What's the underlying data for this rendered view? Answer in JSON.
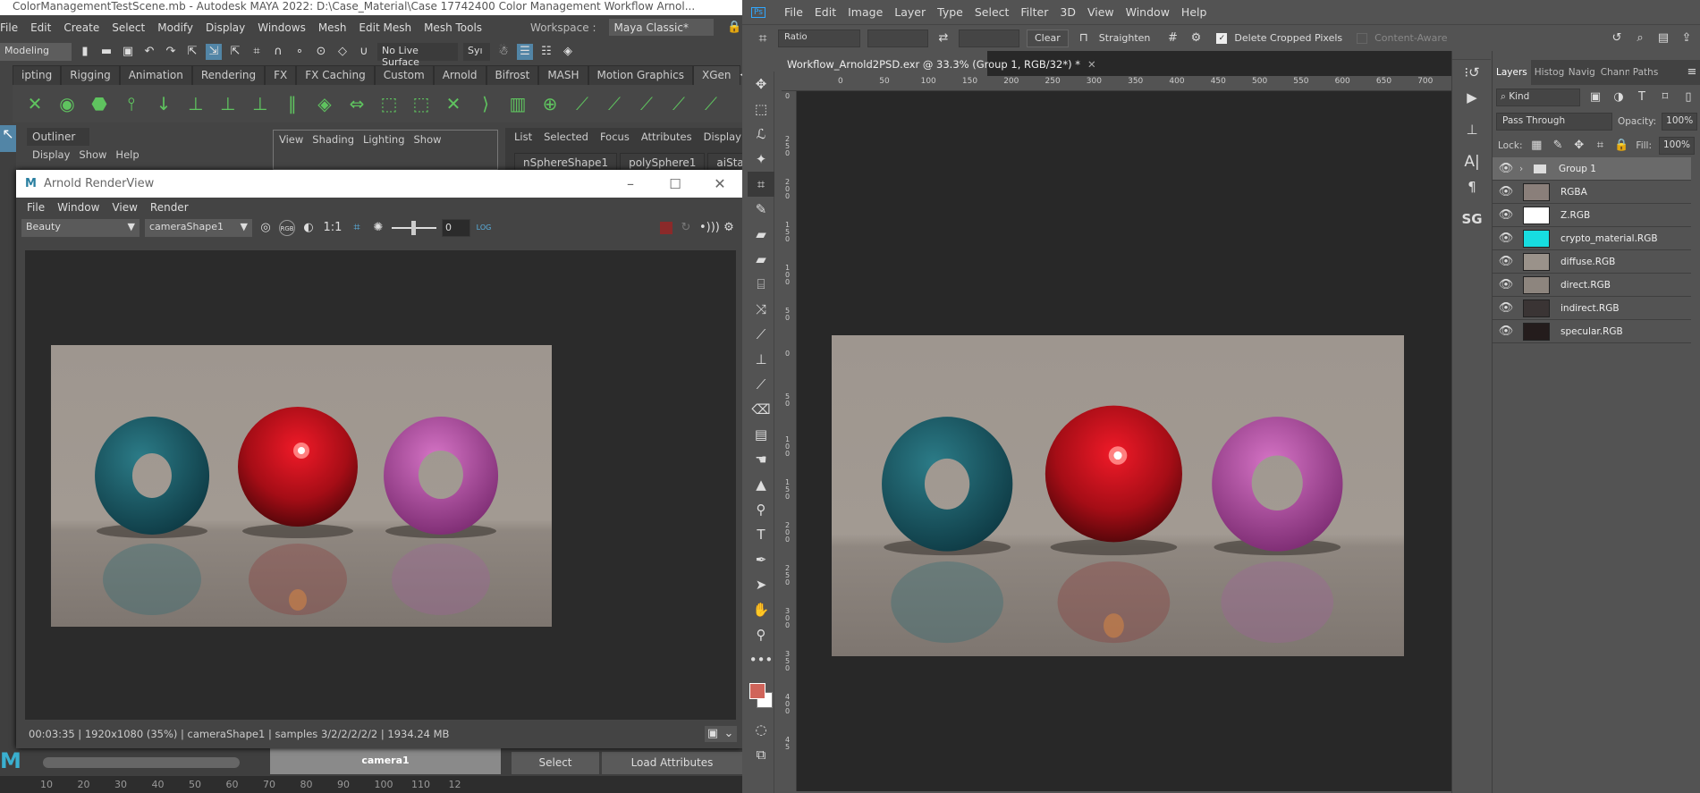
{
  "maya": {
    "title": "ColorManagementTestScene.mb - Autodesk MAYA 2022: D:\\Case_Material\\Case 17742400 Color Management Workflow Arnol...",
    "menu": [
      "File",
      "Edit",
      "Create",
      "Select",
      "Modify",
      "Display",
      "Windows",
      "Mesh",
      "Edit Mesh",
      "Mesh Tools"
    ],
    "workspace_label": "Workspace :",
    "workspace_value": "Maya Classic*",
    "mode": "Modeling",
    "live_surface": "No Live Surface",
    "sym": "Syı",
    "shelf_tabs": [
      "ipting",
      "Rigging",
      "Animation",
      "Rendering",
      "FX",
      "FX Caching",
      "Custom",
      "Arnold",
      "Bifrost",
      "MASH",
      "Motion Graphics",
      "XGen"
    ],
    "active_shelf": "XGen",
    "outliner": {
      "title": "Outliner",
      "menu": [
        "Display",
        "Show",
        "Help"
      ]
    },
    "panel_menu": [
      "View",
      "Shading",
      "Lighting",
      "Show"
    ],
    "attr_menu": [
      "List",
      "Selected",
      "Focus",
      "Attributes",
      "Display"
    ],
    "attr_tabs": [
      "nSphereShape1",
      "polySphere1",
      "aiStandard"
    ],
    "bottom": {
      "camera": "camera1",
      "select": "Select",
      "load_attributes": "Load Attributes"
    },
    "timeline": [
      "10",
      "20",
      "30",
      "40",
      "50",
      "60",
      "70",
      "80",
      "90",
      "100",
      "110",
      "12"
    ]
  },
  "renderview": {
    "title": "Arnold RenderView",
    "menu": [
      "File",
      "Window",
      "View",
      "Render"
    ],
    "aov": "Beauty",
    "camera": "cameraShape1",
    "ratio": "1:1",
    "exposure": "0",
    "log": "LOG",
    "rgb": "RGB",
    "status": "00:03:35 | 1920x1080 (35%) | cameraShape1  | samples 3/2/2/2/2/2 | 1934.24 MB"
  },
  "photoshop": {
    "logo": "Ps",
    "menu": [
      "File",
      "Edit",
      "Image",
      "Layer",
      "Type",
      "Select",
      "Filter",
      "3D",
      "View",
      "Window",
      "Help"
    ],
    "options": {
      "ratio": "Ratio",
      "clear": "Clear",
      "straighten": "Straighten",
      "delete_cropped": "Delete Cropped Pixels",
      "content_aware": "Content-Aware"
    },
    "doc_tab": "Workflow_Arnold2PSD.exr @ 33.3% (Group 1, RGB/32*) *",
    "ruler_top": [
      "0",
      "50",
      "100",
      "150",
      "200",
      "250",
      "300",
      "350",
      "400",
      "450",
      "500",
      "550",
      "600",
      "650",
      "700"
    ],
    "ruler_left": [
      "0",
      "250",
      "200",
      "150",
      "100",
      "50",
      "0",
      "50",
      "100",
      "150",
      "200",
      "250",
      "300",
      "350",
      "400",
      "45"
    ],
    "dock_sg": "SG",
    "layers_panel": {
      "tabs": [
        "Layers",
        "Histog",
        "Navig",
        "Chann",
        "Paths"
      ],
      "filter": "Kind",
      "blend_mode": "Pass Through",
      "opacity_label": "Opacity:",
      "opacity": "100%",
      "lock_label": "Lock:",
      "fill_label": "Fill:",
      "fill": "100%",
      "group": "Group 1",
      "layers": [
        {
          "name": "RGBA",
          "thumb": "#8a7f7a"
        },
        {
          "name": "Z.RGB",
          "thumb": "#ffffff"
        },
        {
          "name": "crypto_material.RGB",
          "thumb": "#17dde0"
        },
        {
          "name": "diffuse.RGB",
          "thumb": "#9a928a"
        },
        {
          "name": "direct.RGB",
          "thumb": "#8d857e"
        },
        {
          "name": "indirect.RGB",
          "thumb": "#3a3434"
        },
        {
          "name": "specular.RGB",
          "thumb": "#241c1c"
        }
      ]
    },
    "foreground_color": "#d0645a",
    "background_color": "#ffffff"
  },
  "colors": {
    "maya_accent": "#5285a6",
    "ps_blue": "#31a8ff",
    "teal": "#1d5c66",
    "red": "#b0101a",
    "pink": "#b04a9a"
  }
}
